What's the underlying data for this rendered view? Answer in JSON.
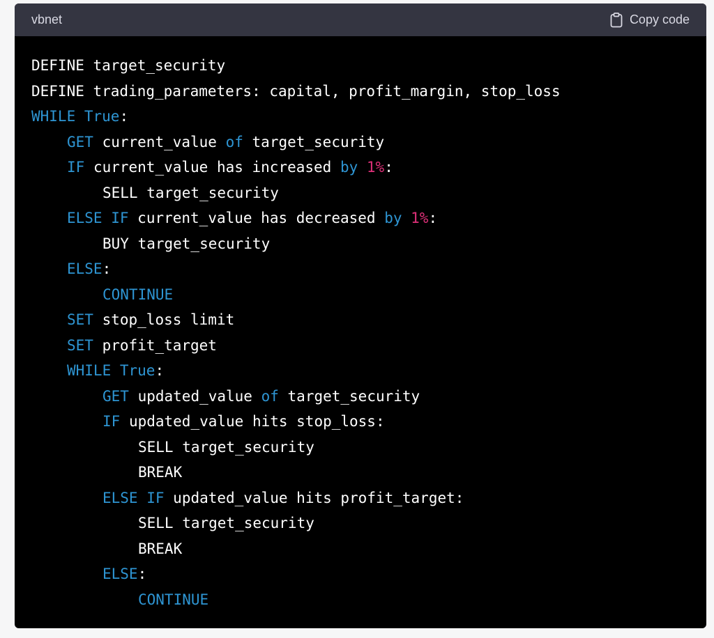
{
  "header": {
    "language": "vbnet",
    "copy_label": "Copy code"
  },
  "colors": {
    "background": "#000000",
    "header_bg": "#343541",
    "plain": "#ffffff",
    "keyword": "#2e95d3",
    "number": "#df3079"
  },
  "code": {
    "lines": [
      {
        "indent": 0,
        "tokens": [
          {
            "t": "plain",
            "v": "DEFINE target_security"
          }
        ]
      },
      {
        "indent": 0,
        "tokens": [
          {
            "t": "plain",
            "v": "DEFINE trading_parameters: capital, profit_margin, stop_loss"
          }
        ]
      },
      {
        "indent": 0,
        "tokens": [
          {
            "t": "keyword",
            "v": "WHILE"
          },
          {
            "t": "plain",
            "v": " "
          },
          {
            "t": "keyword",
            "v": "True"
          },
          {
            "t": "plain",
            "v": ":"
          }
        ]
      },
      {
        "indent": 1,
        "tokens": [
          {
            "t": "keyword",
            "v": "GET"
          },
          {
            "t": "plain",
            "v": " current_value "
          },
          {
            "t": "keyword",
            "v": "of"
          },
          {
            "t": "plain",
            "v": " target_security"
          }
        ]
      },
      {
        "indent": 1,
        "tokens": [
          {
            "t": "keyword",
            "v": "IF"
          },
          {
            "t": "plain",
            "v": " current_value has increased "
          },
          {
            "t": "keyword",
            "v": "by"
          },
          {
            "t": "plain",
            "v": " "
          },
          {
            "t": "number",
            "v": "1%"
          },
          {
            "t": "plain",
            "v": ":"
          }
        ]
      },
      {
        "indent": 2,
        "tokens": [
          {
            "t": "plain",
            "v": "SELL target_security"
          }
        ]
      },
      {
        "indent": 1,
        "tokens": [
          {
            "t": "keyword",
            "v": "ELSE"
          },
          {
            "t": "plain",
            "v": " "
          },
          {
            "t": "keyword",
            "v": "IF"
          },
          {
            "t": "plain",
            "v": " current_value has decreased "
          },
          {
            "t": "keyword",
            "v": "by"
          },
          {
            "t": "plain",
            "v": " "
          },
          {
            "t": "number",
            "v": "1%"
          },
          {
            "t": "plain",
            "v": ":"
          }
        ]
      },
      {
        "indent": 2,
        "tokens": [
          {
            "t": "plain",
            "v": "BUY target_security"
          }
        ]
      },
      {
        "indent": 1,
        "tokens": [
          {
            "t": "keyword",
            "v": "ELSE"
          },
          {
            "t": "plain",
            "v": ":"
          }
        ]
      },
      {
        "indent": 2,
        "tokens": [
          {
            "t": "keyword",
            "v": "CONTINUE"
          }
        ]
      },
      {
        "indent": 1,
        "tokens": [
          {
            "t": "keyword",
            "v": "SET"
          },
          {
            "t": "plain",
            "v": " stop_loss limit"
          }
        ]
      },
      {
        "indent": 1,
        "tokens": [
          {
            "t": "keyword",
            "v": "SET"
          },
          {
            "t": "plain",
            "v": " profit_target"
          }
        ]
      },
      {
        "indent": 1,
        "tokens": [
          {
            "t": "keyword",
            "v": "WHILE"
          },
          {
            "t": "plain",
            "v": " "
          },
          {
            "t": "keyword",
            "v": "True"
          },
          {
            "t": "plain",
            "v": ":"
          }
        ]
      },
      {
        "indent": 2,
        "tokens": [
          {
            "t": "keyword",
            "v": "GET"
          },
          {
            "t": "plain",
            "v": " updated_value "
          },
          {
            "t": "keyword",
            "v": "of"
          },
          {
            "t": "plain",
            "v": " target_security"
          }
        ]
      },
      {
        "indent": 2,
        "tokens": [
          {
            "t": "keyword",
            "v": "IF"
          },
          {
            "t": "plain",
            "v": " updated_value hits stop_loss:"
          }
        ]
      },
      {
        "indent": 3,
        "tokens": [
          {
            "t": "plain",
            "v": "SELL target_security"
          }
        ]
      },
      {
        "indent": 3,
        "tokens": [
          {
            "t": "plain",
            "v": "BREAK"
          }
        ]
      },
      {
        "indent": 2,
        "tokens": [
          {
            "t": "keyword",
            "v": "ELSE"
          },
          {
            "t": "plain",
            "v": " "
          },
          {
            "t": "keyword",
            "v": "IF"
          },
          {
            "t": "plain",
            "v": " updated_value hits profit_target:"
          }
        ]
      },
      {
        "indent": 3,
        "tokens": [
          {
            "t": "plain",
            "v": "SELL target_security"
          }
        ]
      },
      {
        "indent": 3,
        "tokens": [
          {
            "t": "plain",
            "v": "BREAK"
          }
        ]
      },
      {
        "indent": 2,
        "tokens": [
          {
            "t": "keyword",
            "v": "ELSE"
          },
          {
            "t": "plain",
            "v": ":"
          }
        ]
      },
      {
        "indent": 3,
        "tokens": [
          {
            "t": "keyword",
            "v": "CONTINUE"
          }
        ]
      }
    ]
  }
}
